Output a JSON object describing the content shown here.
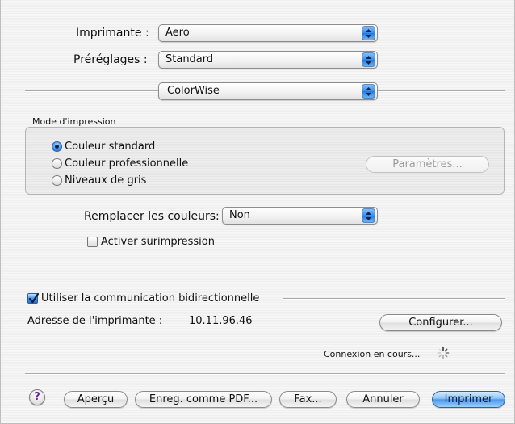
{
  "printer": {
    "label": "Imprimante :",
    "value": "Aero"
  },
  "presets": {
    "label": "Préréglages :",
    "value": "Standard"
  },
  "panel": {
    "value": "ColorWise"
  },
  "print_mode": {
    "group_label": "Mode d'impression",
    "options": [
      {
        "label": "Couleur standard",
        "selected": true
      },
      {
        "label": "Couleur professionnelle",
        "selected": false
      },
      {
        "label": "Niveaux de gris",
        "selected": false
      }
    ],
    "settings_button": "Paramètres..."
  },
  "replace_colors": {
    "label": "Remplacer les couleurs:",
    "value": "Non"
  },
  "overprint": {
    "label": "Activer surimpression",
    "checked": false
  },
  "bidirectional": {
    "label": "Utiliser la communication bidirectionnelle",
    "checked": true
  },
  "printer_address": {
    "label": "Adresse de l'imprimante :",
    "value": "10.11.96.46"
  },
  "configure_button": "Configurer...",
  "connection_status": "Connexion en cours...",
  "footer": {
    "help": "?",
    "preview": "Aperçu",
    "save_pdf": "Enreg. comme PDF...",
    "fax": "Fax...",
    "cancel": "Annuler",
    "print": "Imprimer"
  },
  "colors": {
    "accent": "#3a8ce9",
    "help_glyph": "#6b1fa0"
  },
  "icons": {
    "popup_arrow": "updown-arrows-icon",
    "spinner": "progress-spinner-icon",
    "checkmark": "checkmark-icon"
  }
}
